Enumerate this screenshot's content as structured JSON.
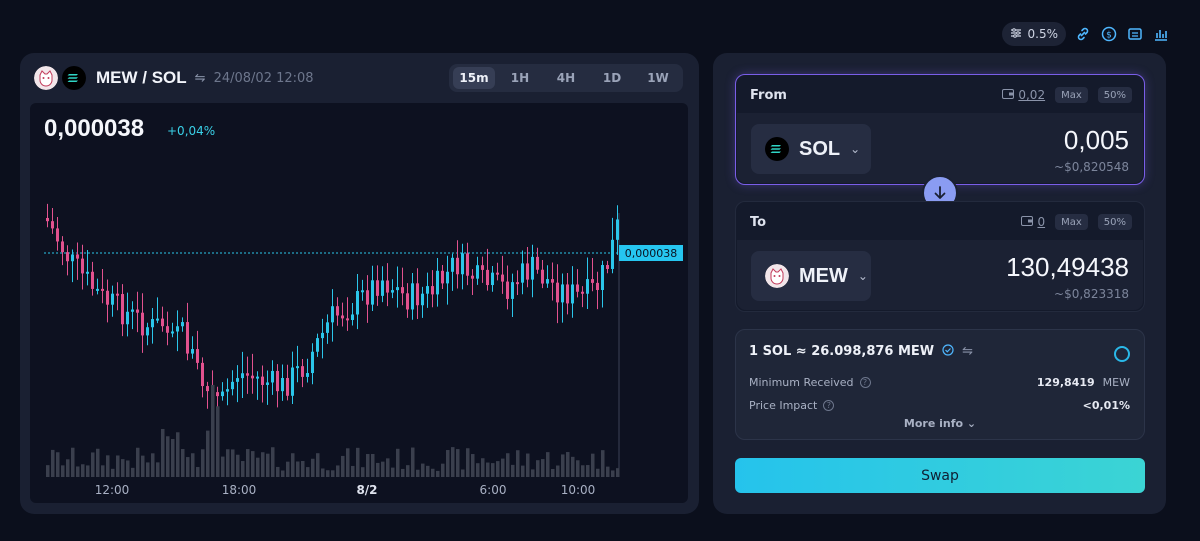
{
  "toolbar": {
    "slippage": "0.5%",
    "icons": [
      "settings-sliders-icon",
      "link-icon",
      "dollar-icon",
      "route-icon",
      "chart-bars-icon"
    ]
  },
  "chart_panel": {
    "pair": "MEW / SOL",
    "datetime": "24/08/02 12:08",
    "timeframes": [
      "15m",
      "1H",
      "4H",
      "1D",
      "1W"
    ],
    "active_timeframe": "15m",
    "price": "0,000038",
    "change": "+0,04%",
    "last_price_tag": "0,000038"
  },
  "chart_data": {
    "type": "candlestick",
    "x_ticks": [
      "12:00",
      "18:00",
      "8/2",
      "6:00",
      "10:00"
    ],
    "colors": {
      "up": "#2bc6ea",
      "down": "#e2528f",
      "volume": "#3a3f4d"
    }
  },
  "swap_panel": {
    "from": {
      "label": "From",
      "balance": "0,02",
      "max_label": "Max",
      "half_label": "50%",
      "token": "SOL",
      "amount": "0,005",
      "usd": "~$0,820548"
    },
    "to": {
      "label": "To",
      "balance": "0",
      "max_label": "Max",
      "half_label": "50%",
      "token": "MEW",
      "amount": "130,49438",
      "usd": "~$0,823318"
    },
    "info": {
      "rate": "1 SOL ≈ 26.098,876 MEW",
      "min_received_label": "Minimum Received",
      "min_received_value": "129,8419",
      "min_received_unit": "MEW",
      "price_impact_label": "Price Impact",
      "price_impact_value": "<0,01%",
      "more_info": "More info ⌄"
    },
    "swap_label": "Swap"
  }
}
